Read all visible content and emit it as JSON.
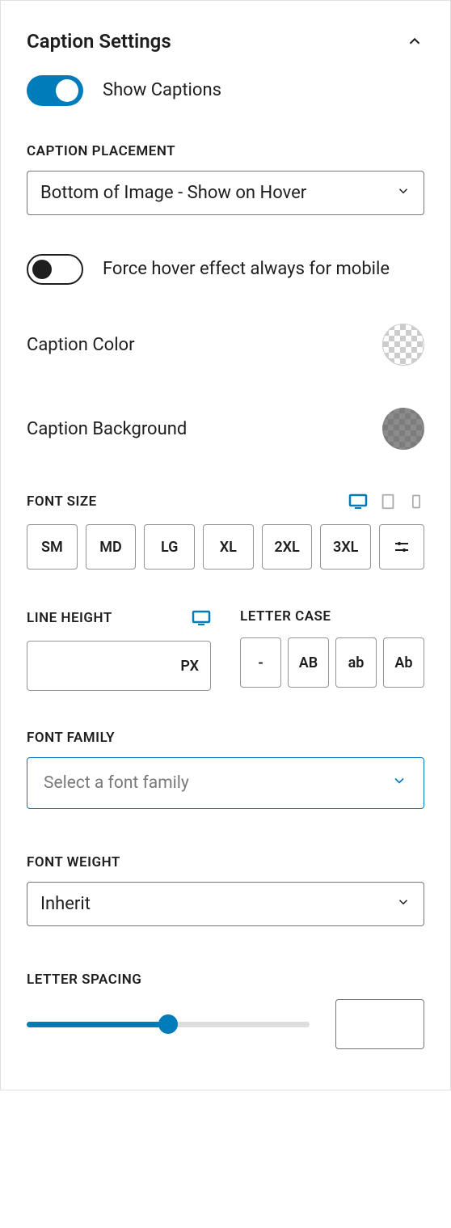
{
  "panel": {
    "title": "Caption Settings"
  },
  "showCaptions": {
    "label": "Show Captions",
    "on": true
  },
  "captionPlacement": {
    "label": "Caption Placement",
    "value": "Bottom of Image - Show on Hover"
  },
  "forceHover": {
    "label": "Force hover effect always for mobile",
    "on": false
  },
  "captionColor": {
    "label": "Caption Color",
    "value": "transparent"
  },
  "captionBackground": {
    "label": "Caption Background",
    "value": "rgba(90,90,90,0.7)"
  },
  "fontSize": {
    "label": "Font Size",
    "options": [
      "SM",
      "MD",
      "LG",
      "XL",
      "2XL",
      "3XL"
    ],
    "activeDevice": "desktop"
  },
  "lineHeight": {
    "label": "Line Height",
    "unit": "PX",
    "value": "",
    "activeDevice": "desktop"
  },
  "letterCase": {
    "label": "Letter Case",
    "options": [
      "-",
      "AB",
      "ab",
      "Ab"
    ]
  },
  "fontFamily": {
    "label": "Font Family",
    "placeholder": "Select a font family",
    "value": ""
  },
  "fontWeight": {
    "label": "Font Weight",
    "value": "Inherit"
  },
  "letterSpacing": {
    "label": "Letter Spacing",
    "value": "",
    "sliderPercent": 50
  }
}
